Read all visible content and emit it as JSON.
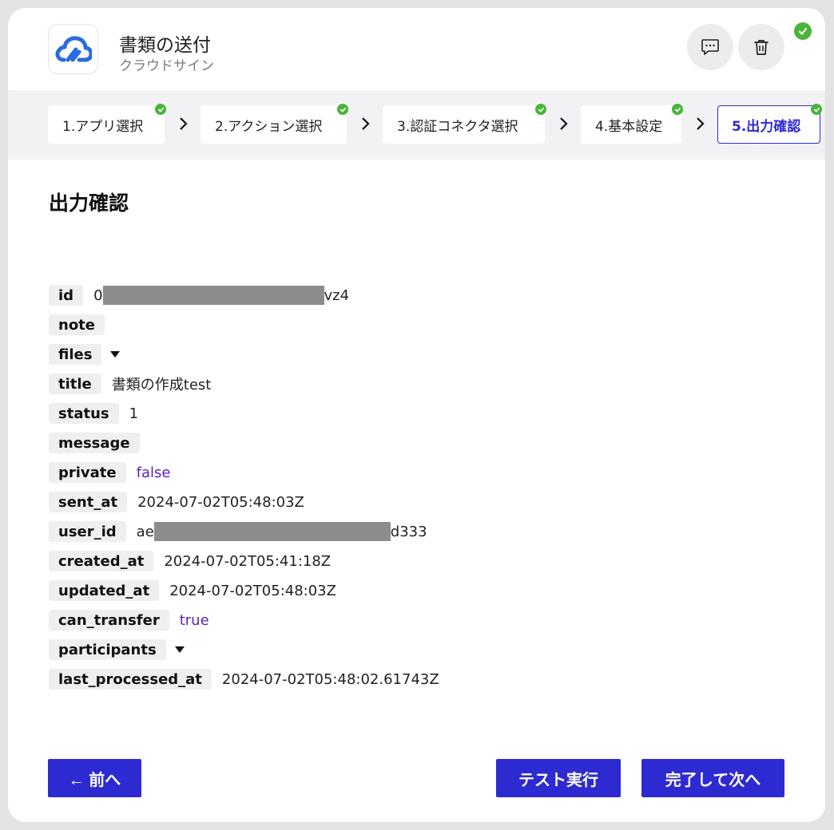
{
  "header": {
    "title": "書類の送付",
    "subtitle": "クラウドサイン",
    "logo_icon": "cloudsign-logo",
    "comment_icon": "comment-icon",
    "trash_icon": "trash-icon",
    "status_icon": "check-circle-icon"
  },
  "steps": [
    {
      "label": "1.アプリ選択",
      "done": true
    },
    {
      "label": "2.アクション選択",
      "done": true
    },
    {
      "label": "3.認証コネクタ選択",
      "done": true
    },
    {
      "label": "4.基本設定",
      "done": true
    },
    {
      "label": "5.出力確認",
      "done": true,
      "active": true
    }
  ],
  "section_title": "出力確認",
  "fields": [
    {
      "key": "id",
      "value_prefix": "0",
      "value_suffix": "vz4",
      "redacted": true
    },
    {
      "key": "note",
      "value": ""
    },
    {
      "key": "files",
      "expandable": true
    },
    {
      "key": "title",
      "value": "書類の作成test"
    },
    {
      "key": "status",
      "value": "1"
    },
    {
      "key": "message",
      "value": ""
    },
    {
      "key": "private",
      "value": "false",
      "boolean": true
    },
    {
      "key": "sent_at",
      "value": "2024-07-02T05:48:03Z"
    },
    {
      "key": "user_id",
      "value_prefix": "ae",
      "value_suffix": "d333",
      "redacted": true
    },
    {
      "key": "created_at",
      "value": "2024-07-02T05:41:18Z"
    },
    {
      "key": "updated_at",
      "value": "2024-07-02T05:48:03Z"
    },
    {
      "key": "can_transfer",
      "value": "true",
      "boolean": true
    },
    {
      "key": "participants",
      "expandable": true
    },
    {
      "key": "last_processed_at",
      "value": "2024-07-02T05:48:02.61743Z"
    }
  ],
  "footer": {
    "back_label": "← 前へ",
    "test_label": "テスト実行",
    "finish_label": "完了して次へ"
  },
  "colors": {
    "accent": "#2e2ad2",
    "success": "#47b53a",
    "boolean": "#5a1fbf"
  }
}
